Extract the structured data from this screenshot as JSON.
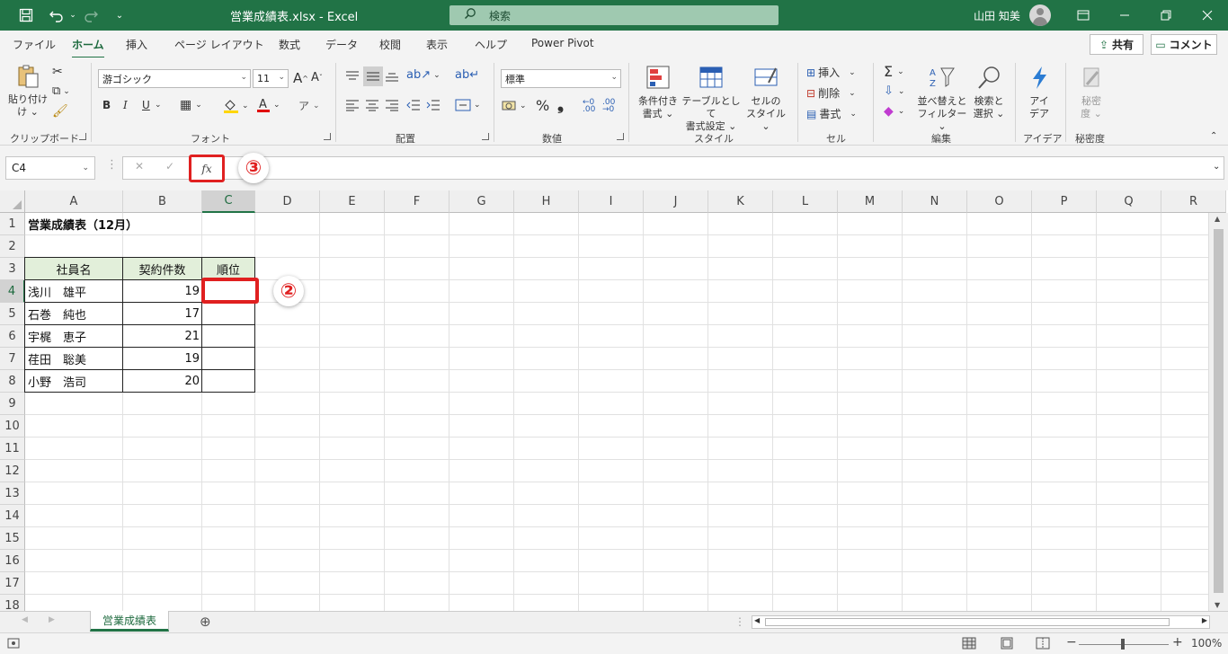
{
  "title_bar": {
    "document_title": "営業成績表.xlsx  -  Excel",
    "search_placeholder": "検索",
    "user_name": "山田 知美",
    "icons": [
      "save-icon",
      "undo-icon",
      "redo-icon",
      "customize-qat-icon",
      "search-icon",
      "ribbon-display-icon",
      "minimize-icon",
      "restore-icon",
      "close-icon"
    ]
  },
  "tabs": [
    "ファイル",
    "ホーム",
    "挿入",
    "ページ レイアウト",
    "数式",
    "データ",
    "校閲",
    "表示",
    "ヘルプ",
    "Power Pivot"
  ],
  "active_tab": "ホーム",
  "share_label": "共有",
  "comment_label": "コメント",
  "ribbon": {
    "clipboard": {
      "paste_line1": "貼り付け",
      "paste_line2": "け ⌄",
      "group": "クリップボード"
    },
    "font": {
      "font_name": "游ゴシック",
      "font_size": "11",
      "group": "フォント",
      "bold": "B",
      "italic": "I",
      "underline": "U",
      "grow": "A",
      "shrink": "A"
    },
    "alignment": {
      "group": "配置"
    },
    "number": {
      "format": "標準",
      "percent": "%",
      "comma": "❟",
      "group": "数値"
    },
    "styles": {
      "cond_format_line1": "条件付き",
      "cond_format_line2": "書式 ⌄",
      "table_line1": "テーブルとして",
      "table_line2": "書式設定 ⌄",
      "cell_style_line1": "セルの",
      "cell_style_line2": "スタイル ⌄",
      "group": "スタイル"
    },
    "cells": {
      "insert": "挿入",
      "delete": "削除",
      "format": "書式",
      "group": "セル"
    },
    "editing": {
      "sort_line1": "並べ替えと",
      "sort_line2": "フィルター ⌄",
      "find_line1": "検索と",
      "find_line2": "選択 ⌄",
      "group": "編集"
    },
    "ideas": {
      "line1": "アイ",
      "line2": "デア",
      "group": "アイデア"
    },
    "sensitivity": {
      "line1": "秘密",
      "line2": "度 ⌄",
      "group": "秘密度"
    }
  },
  "formula_bar": {
    "name_box": "C4",
    "cancel": "✕",
    "enter": "✓",
    "fx": "fx",
    "formula": ""
  },
  "annotations": {
    "step2": "②",
    "step3": "③"
  },
  "columns": [
    "A",
    "B",
    "C",
    "D",
    "E",
    "F",
    "G",
    "H",
    "I",
    "J",
    "K",
    "L",
    "M",
    "N",
    "O",
    "P",
    "Q",
    "R"
  ],
  "rows": [
    "1",
    "2",
    "3",
    "4",
    "5",
    "6",
    "7",
    "8",
    "9",
    "10",
    "11",
    "12",
    "13",
    "14",
    "15",
    "16",
    "17",
    "18"
  ],
  "sheet": {
    "title": "営業成績表（12月）",
    "headers": [
      "社員名",
      "契約件数",
      "順位"
    ],
    "records": [
      {
        "name": "浅川　雄平",
        "count": "19",
        "rank": ""
      },
      {
        "name": "石巻　純也",
        "count": "17",
        "rank": ""
      },
      {
        "name": "宇梶　恵子",
        "count": "21",
        "rank": ""
      },
      {
        "name": "荏田　聡美",
        "count": "19",
        "rank": ""
      },
      {
        "name": "小野　浩司",
        "count": "20",
        "rank": ""
      }
    ]
  },
  "selected_cell": "C4",
  "sheet_tabs": [
    "営業成績表"
  ],
  "add_sheet": "⊕",
  "status_bar": {
    "zoom": "100%"
  },
  "colors": {
    "excel_green": "#217346",
    "header_fill": "#e2efda",
    "highlight_red": "#e02020"
  }
}
